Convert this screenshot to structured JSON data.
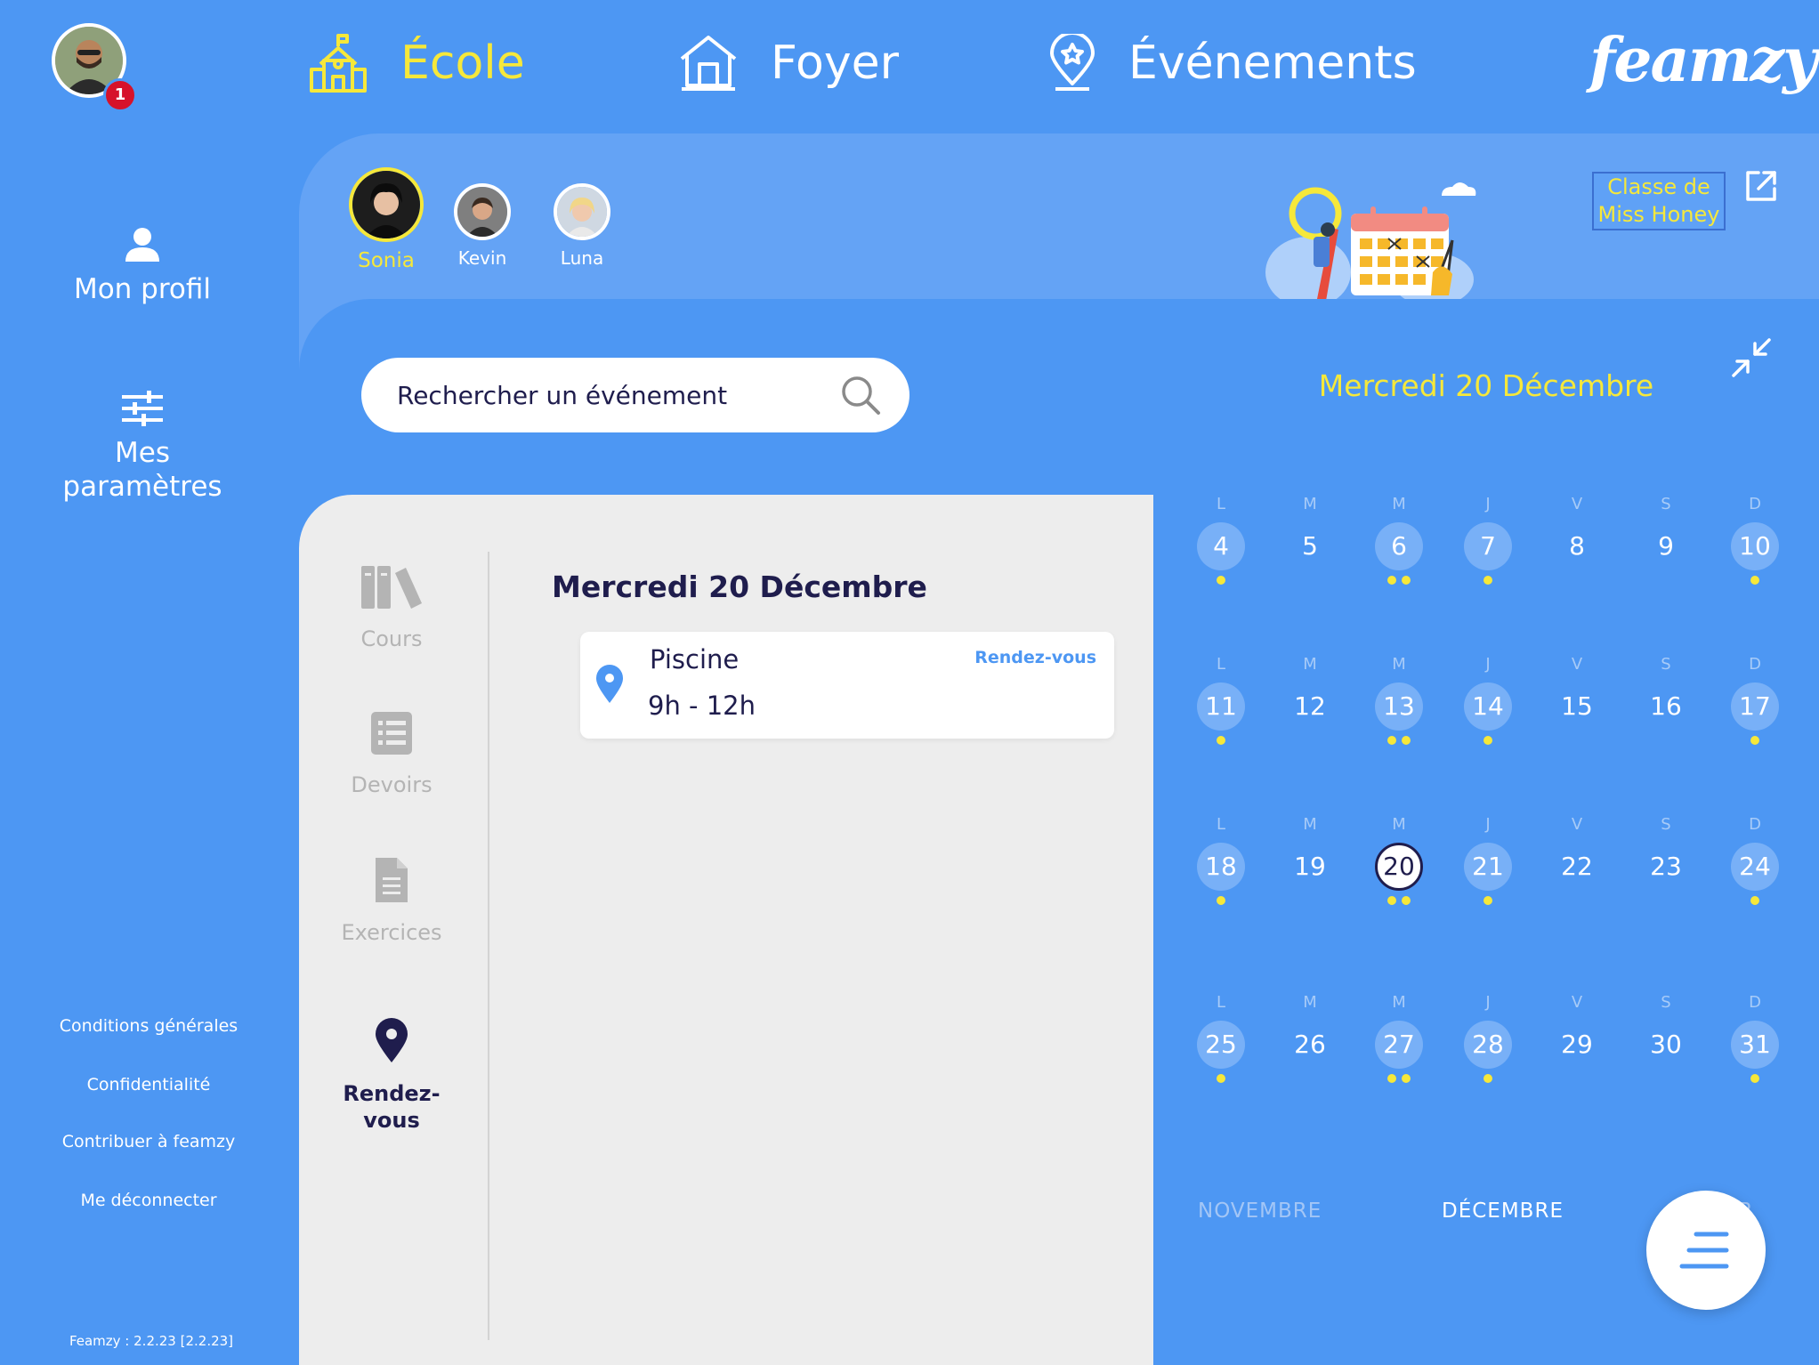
{
  "sidebar": {
    "notification_count": "1",
    "profile_label": "Mon profil",
    "settings_label": "Mes paramètres",
    "links": [
      "Conditions générales",
      "Confidentialité",
      "Contribuer à feamzy",
      "Me déconnecter"
    ],
    "version": "Feamzy : 2.2.23 [2.2.23]"
  },
  "nav": {
    "tabs": [
      {
        "label": "École",
        "icon": "school-icon",
        "active": true
      },
      {
        "label": "Foyer",
        "icon": "house-icon",
        "active": false
      },
      {
        "label": "Événements",
        "icon": "location-star-icon",
        "active": false
      }
    ],
    "logo_text": "feamzy",
    "logo_suffix": ":"
  },
  "children": [
    {
      "name": "Sonia",
      "active": true
    },
    {
      "name": "Kevin",
      "active": false
    },
    {
      "name": "Luna",
      "active": false
    }
  ],
  "class_link": "Classe de Miss Honey",
  "search": {
    "placeholder": "Rechercher un événement",
    "value": ""
  },
  "selected_date_heading": "Mercredi 20 Décembre",
  "categories": [
    {
      "label": "Cours",
      "icon": "books-icon",
      "active": false
    },
    {
      "label": "Devoirs",
      "icon": "list-icon",
      "active": false
    },
    {
      "label": "Exercices",
      "icon": "document-icon",
      "active": false
    },
    {
      "label": "Rendez-vous",
      "icon": "location-pin-icon",
      "active": true
    }
  ],
  "day_view": {
    "title": "Mercredi 20 Décembre",
    "events": [
      {
        "name": "Piscine",
        "time": "9h - 12h",
        "type": "Rendez-vous"
      }
    ]
  },
  "calendar": {
    "weekdays": [
      "L",
      "M",
      "M",
      "J",
      "V",
      "S",
      "D"
    ],
    "weeks": [
      [
        {
          "d": "4",
          "hl": true,
          "dots": 1
        },
        {
          "d": "5",
          "hl": false,
          "dots": 0
        },
        {
          "d": "6",
          "hl": true,
          "dots": 2
        },
        {
          "d": "7",
          "hl": true,
          "dots": 1
        },
        {
          "d": "8",
          "hl": false,
          "dots": 0
        },
        {
          "d": "9",
          "hl": false,
          "dots": 0
        },
        {
          "d": "10",
          "hl": true,
          "dots": 1
        }
      ],
      [
        {
          "d": "11",
          "hl": true,
          "dots": 1
        },
        {
          "d": "12",
          "hl": false,
          "dots": 0
        },
        {
          "d": "13",
          "hl": true,
          "dots": 2
        },
        {
          "d": "14",
          "hl": true,
          "dots": 1
        },
        {
          "d": "15",
          "hl": false,
          "dots": 0
        },
        {
          "d": "16",
          "hl": false,
          "dots": 0
        },
        {
          "d": "17",
          "hl": true,
          "dots": 1
        }
      ],
      [
        {
          "d": "18",
          "hl": true,
          "dots": 1
        },
        {
          "d": "19",
          "hl": false,
          "dots": 0
        },
        {
          "d": "20",
          "hl": true,
          "dots": 2,
          "selected": true
        },
        {
          "d": "21",
          "hl": true,
          "dots": 1
        },
        {
          "d": "22",
          "hl": false,
          "dots": 0
        },
        {
          "d": "23",
          "hl": false,
          "dots": 0
        },
        {
          "d": "24",
          "hl": true,
          "dots": 1
        }
      ],
      [
        {
          "d": "25",
          "hl": true,
          "dots": 1
        },
        {
          "d": "26",
          "hl": false,
          "dots": 0
        },
        {
          "d": "27",
          "hl": true,
          "dots": 2
        },
        {
          "d": "28",
          "hl": true,
          "dots": 1
        },
        {
          "d": "29",
          "hl": false,
          "dots": 0
        },
        {
          "d": "30",
          "hl": false,
          "dots": 0
        },
        {
          "d": "31",
          "hl": true,
          "dots": 1
        }
      ]
    ],
    "months": {
      "prev": "NOVEMBRE",
      "current": "DÉCEMBRE",
      "next": "ER"
    }
  },
  "colors": {
    "accent_yellow": "#F6E83A",
    "background_blue": "#4D97F3",
    "dark_navy": "#1F1D4D"
  }
}
